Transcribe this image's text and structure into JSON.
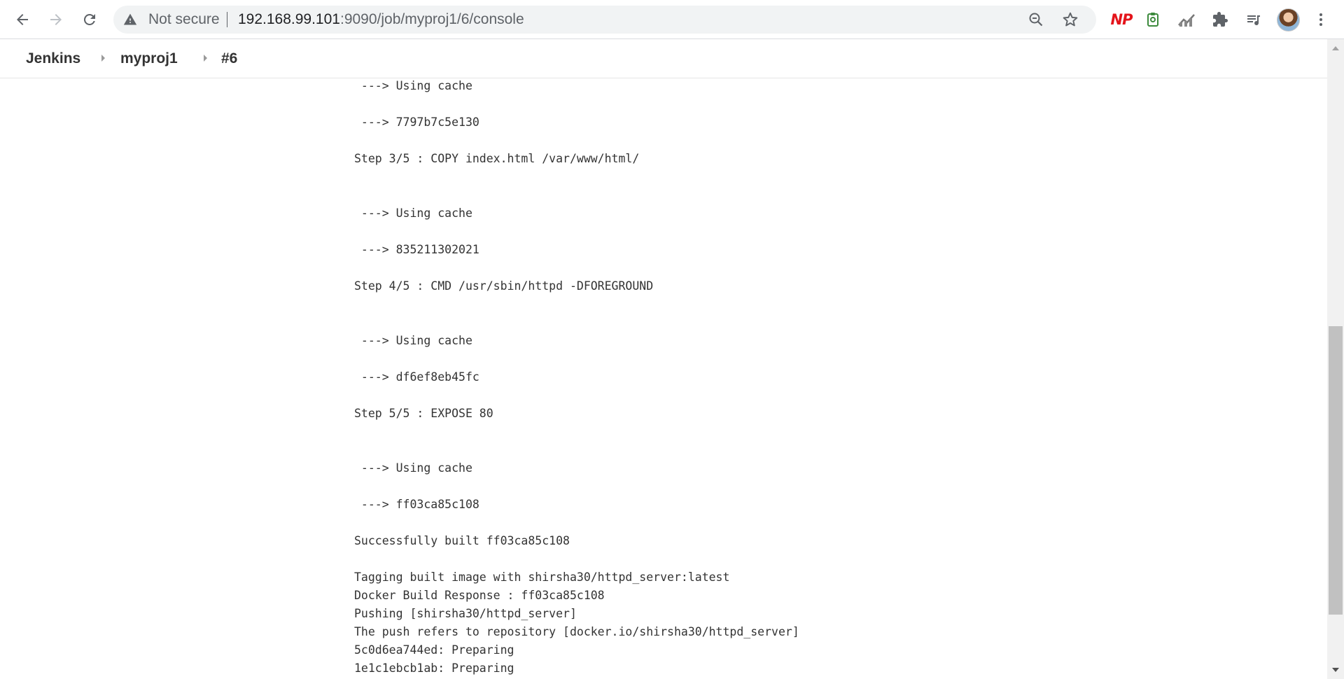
{
  "browser": {
    "security_label": "Not secure",
    "url_host": "192.168.99.101",
    "url_rest": ":9090/job/myproj1/6/console",
    "icons": [
      "back-arrow-icon",
      "forward-arrow-icon",
      "reload-icon",
      "warning-icon",
      "zoom-out-icon",
      "bookmark-star-icon",
      "extensions-icon",
      "media-control-icon",
      "profile-avatar",
      "menu-kebab-icon"
    ],
    "extensions": {
      "np_label": "NP"
    }
  },
  "breadcrumb": {
    "items": [
      "Jenkins",
      "myproj1",
      "#6"
    ]
  },
  "console": {
    "lines": [
      " ---> Using cache",
      " ---> 7797b7c5e130",
      "Step 3/5 : COPY index.html /var/www/html/",
      " ---> Using cache",
      " ---> 835211302021",
      "Step 4/5 : CMD /usr/sbin/httpd -DFOREGROUND",
      " ---> Using cache",
      " ---> df6ef8eb45fc",
      "Step 5/5 : EXPOSE 80",
      " ---> Using cache",
      " ---> ff03ca85c108",
      "Successfully built ff03ca85c108",
      "Tagging built image with shirsha30/httpd_server:latest",
      "Docker Build Response : ff03ca85c108",
      "Pushing [shirsha30/httpd_server]",
      "The push refers to repository [docker.io/shirsha30/httpd_server]",
      "5c0d6ea744ed: Preparing",
      "1e1c1ebcb1ab: Preparing"
    ]
  },
  "colors": {
    "text": "#333333",
    "np_brand": "#e4141b",
    "chrome_icon": "#5f6368"
  }
}
